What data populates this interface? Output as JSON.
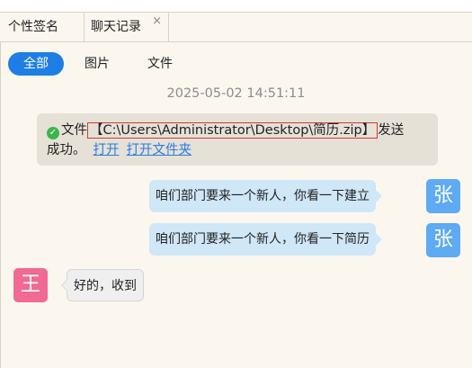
{
  "tabs": [
    {
      "label": "个性签名"
    },
    {
      "label": "聊天记录",
      "close": "×"
    }
  ],
  "filters": [
    "全部",
    "图片",
    "文件"
  ],
  "timestamp": "2025-05-02 14:51:11",
  "system_message": {
    "icon": "check-circle-icon",
    "prefix": "文件",
    "path": "【C:\\Users\\Administrator\\Desktop\\简历.zip】",
    "after_path": "发送",
    "line2": "成功。",
    "open_link": "打开",
    "open_folder_link": "打开文件夹"
  },
  "messages": [
    {
      "side": "right",
      "avatar": "张",
      "text": "咱们部门要来一个新人，你看一下建立"
    },
    {
      "side": "right",
      "avatar": "张",
      "text": "咱们部门要来一个新人，你看一下简历"
    },
    {
      "side": "left",
      "avatar": "王",
      "text": "好的，收到"
    }
  ],
  "colors": {
    "active_filter": "#1e7ee6",
    "avatar_zhang": "#5eaaf3",
    "avatar_wang": "#f06a93",
    "success": "#3bb54a",
    "link": "#2d7ce0",
    "highlight_border": "#d23a3a"
  }
}
